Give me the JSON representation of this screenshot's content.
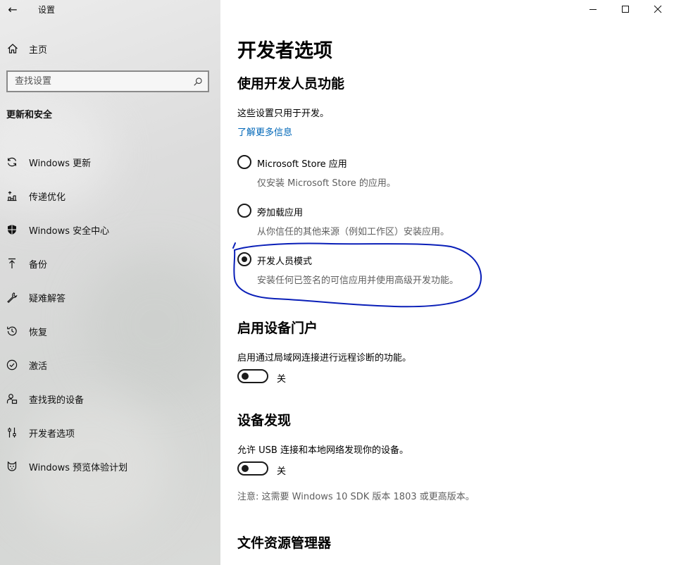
{
  "window": {
    "app_title": "设置",
    "back_glyph": "←",
    "controls": [
      "minimize-icon",
      "maximize-icon",
      "close-icon"
    ]
  },
  "sidebar": {
    "home_label": "主页",
    "search_placeholder": "查找设置",
    "section_title": "更新和安全",
    "items": [
      {
        "label": "Windows 更新",
        "icon": "sync-icon"
      },
      {
        "label": "传递优化",
        "icon": "delivery-optimization-icon"
      },
      {
        "label": "Windows 安全中心",
        "icon": "shield-icon"
      },
      {
        "label": "备份",
        "icon": "backup-arrow-icon"
      },
      {
        "label": "疑难解答",
        "icon": "wrench-icon"
      },
      {
        "label": "恢复",
        "icon": "recovery-icon"
      },
      {
        "label": "激活",
        "icon": "check-circle-icon"
      },
      {
        "label": "查找我的设备",
        "icon": "person-find-icon"
      },
      {
        "label": "开发者选项",
        "icon": "developer-icon"
      },
      {
        "label": "Windows 预览体验计划",
        "icon": "insider-cat-icon"
      }
    ]
  },
  "main": {
    "page_title": "开发者选项",
    "dev_features": {
      "heading": "使用开发人员功能",
      "description": "这些设置只用于开发。",
      "learn_more": "了解更多信息",
      "options": [
        {
          "label": "Microsoft Store 应用",
          "description": "仅安装 Microsoft Store 的应用。",
          "checked": false
        },
        {
          "label": "旁加载应用",
          "description": "从你信任的其他来源（例如工作区）安装应用。",
          "checked": false
        },
        {
          "label": "开发人员模式",
          "description": "安装任何已签名的可信应用并使用高级开发功能。",
          "checked": true
        }
      ]
    },
    "device_portal": {
      "heading": "启用设备门户",
      "description": "启用通过局域网连接进行远程诊断的功能。",
      "toggle_state": "关",
      "enabled": false
    },
    "device_discovery": {
      "heading": "设备发现",
      "description": "允许 USB 连接和本地网络发现你的设备。",
      "toggle_state": "关",
      "enabled": false,
      "note": "注意: 这需要 Windows 10 SDK 版本 1803 或更高版本。"
    },
    "file_explorer": {
      "heading": "文件资源管理器"
    }
  },
  "colors": {
    "link": "#0067b8",
    "annotation": "#0a1fb8",
    "subtext": "#5f5f5f"
  }
}
